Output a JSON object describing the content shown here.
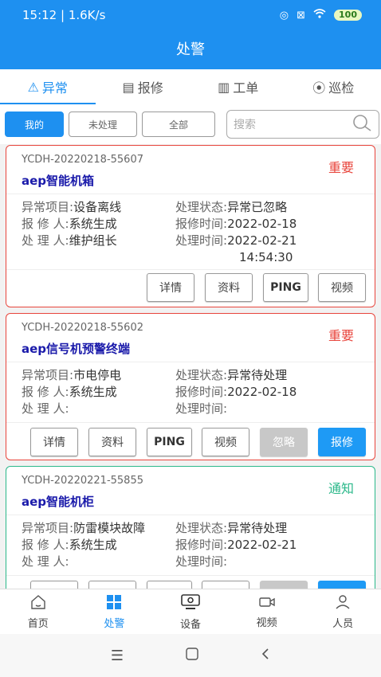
{
  "status_bar": {
    "time_speed": "15:12 | 1.6K/s",
    "battery": "100"
  },
  "header": {
    "title": "处警"
  },
  "tabs": [
    {
      "label": "异常",
      "icon": "warning-icon",
      "active": true
    },
    {
      "label": "报修",
      "icon": "report-icon",
      "active": false
    },
    {
      "label": "工单",
      "icon": "clipboard-icon",
      "active": false
    },
    {
      "label": "巡检",
      "icon": "location-icon",
      "active": false
    }
  ],
  "filters": {
    "mine": "我的",
    "unhandled": "未处理",
    "all": "全部",
    "search_placeholder": "搜索"
  },
  "labels": {
    "item": "异常项目:",
    "status": "处理状态:",
    "reporter": "报 修 人:",
    "report_time": "报修时间:",
    "handler": "处 理 人:",
    "handle_time": "处理时间:"
  },
  "cards": [
    {
      "code": "YCDH-20220218-55607",
      "name": "aep智能机箱",
      "level": "重要",
      "item": "设备离线",
      "status": "异常已忽略",
      "reporter": "系统生成",
      "report_time": "2022-02-18",
      "handler": "维护组长",
      "handle_time_1": "2022-02-21",
      "handle_time_2": "14:54:30",
      "buttons": [
        "详情",
        "资料",
        "PING",
        "视频"
      ]
    },
    {
      "code": "YCDH-20220218-55602",
      "name": "aep信号机预警终端",
      "level": "重要",
      "item": "市电停电",
      "status": "异常待处理",
      "reporter": "系统生成",
      "report_time": "2022-02-18",
      "handler": "",
      "handle_time_1": "",
      "buttons": [
        "详情",
        "资料",
        "PING",
        "视频",
        "忽略",
        "报修"
      ]
    },
    {
      "code": "YCDH-20220221-55855",
      "name": "aep智能机柜",
      "level": "通知",
      "item": "防雷模块故障",
      "status": "异常待处理",
      "reporter": "系统生成",
      "report_time": "2022-02-21",
      "handler": "",
      "handle_time_1": ""
    }
  ],
  "bottom_nav": [
    {
      "label": "首页",
      "icon": "home-icon"
    },
    {
      "label": "处警",
      "icon": "grid-icon",
      "active": true
    },
    {
      "label": "设备",
      "icon": "monitor-icon"
    },
    {
      "label": "视频",
      "icon": "camera-icon"
    },
    {
      "label": "人员",
      "icon": "person-icon"
    }
  ],
  "colors": {
    "primary": "#1e90f0",
    "important": "#e8453c",
    "notice": "#2bb88a"
  }
}
